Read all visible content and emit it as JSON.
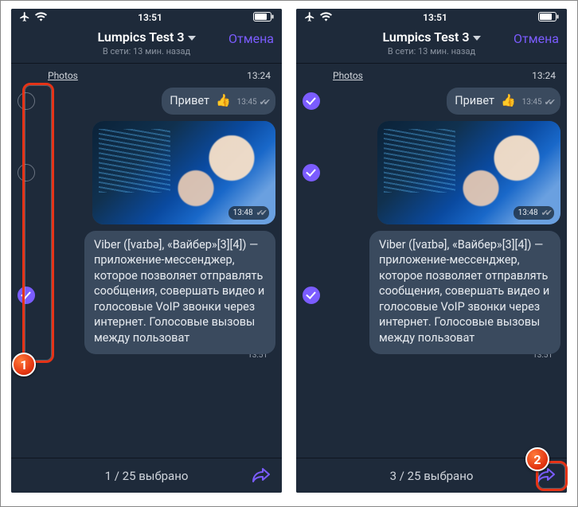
{
  "left": {
    "status": {
      "time": "13:51"
    },
    "header": {
      "title": "Lumpics Test 3",
      "subtitle": "В сети: 13 мин. назад",
      "cancel": "Отмена"
    },
    "photos": {
      "label": "Photos",
      "time": "13:24"
    },
    "msg1": {
      "text": "Привет",
      "emoji": "👍",
      "time": "13:45"
    },
    "msg2": {
      "time": "13:48"
    },
    "msg3": {
      "text": "Viber ([vaɪbə], «Вайбер»[3][4]) — приложение-мессенджер, которое позволяет отправлять сообщения, совершать видео и голосовые VoIP звонки через интернет. Голосовые вызовы между пользоват",
      "time": "13:51"
    },
    "footer": {
      "count": "1 / 25 выбрано"
    },
    "selection": {
      "m1": false,
      "m2": false,
      "m3": true
    }
  },
  "right": {
    "status": {
      "time": "13:51"
    },
    "header": {
      "title": "Lumpics Test 3",
      "subtitle": "В сети: 13 мин. назад",
      "cancel": "Отмена"
    },
    "photos": {
      "label": "Photos",
      "time": "13:24"
    },
    "msg1": {
      "text": "Привет",
      "emoji": "👍",
      "time": "13:45"
    },
    "msg2": {
      "time": "13:48"
    },
    "msg3": {
      "text": "Viber ([vaɪbə], «Вайбер»[3][4]) — приложение-мессенджер, которое позволяет отправлять сообщения, совершать видео и голосовые VoIP звонки через интернет. Голосовые вызовы между пользоват",
      "time": "13:51"
    },
    "footer": {
      "count": "3 / 25 выбрано"
    },
    "selection": {
      "m1": true,
      "m2": true,
      "m3": true
    }
  },
  "annotations": {
    "badge1": "1",
    "badge2": "2"
  }
}
